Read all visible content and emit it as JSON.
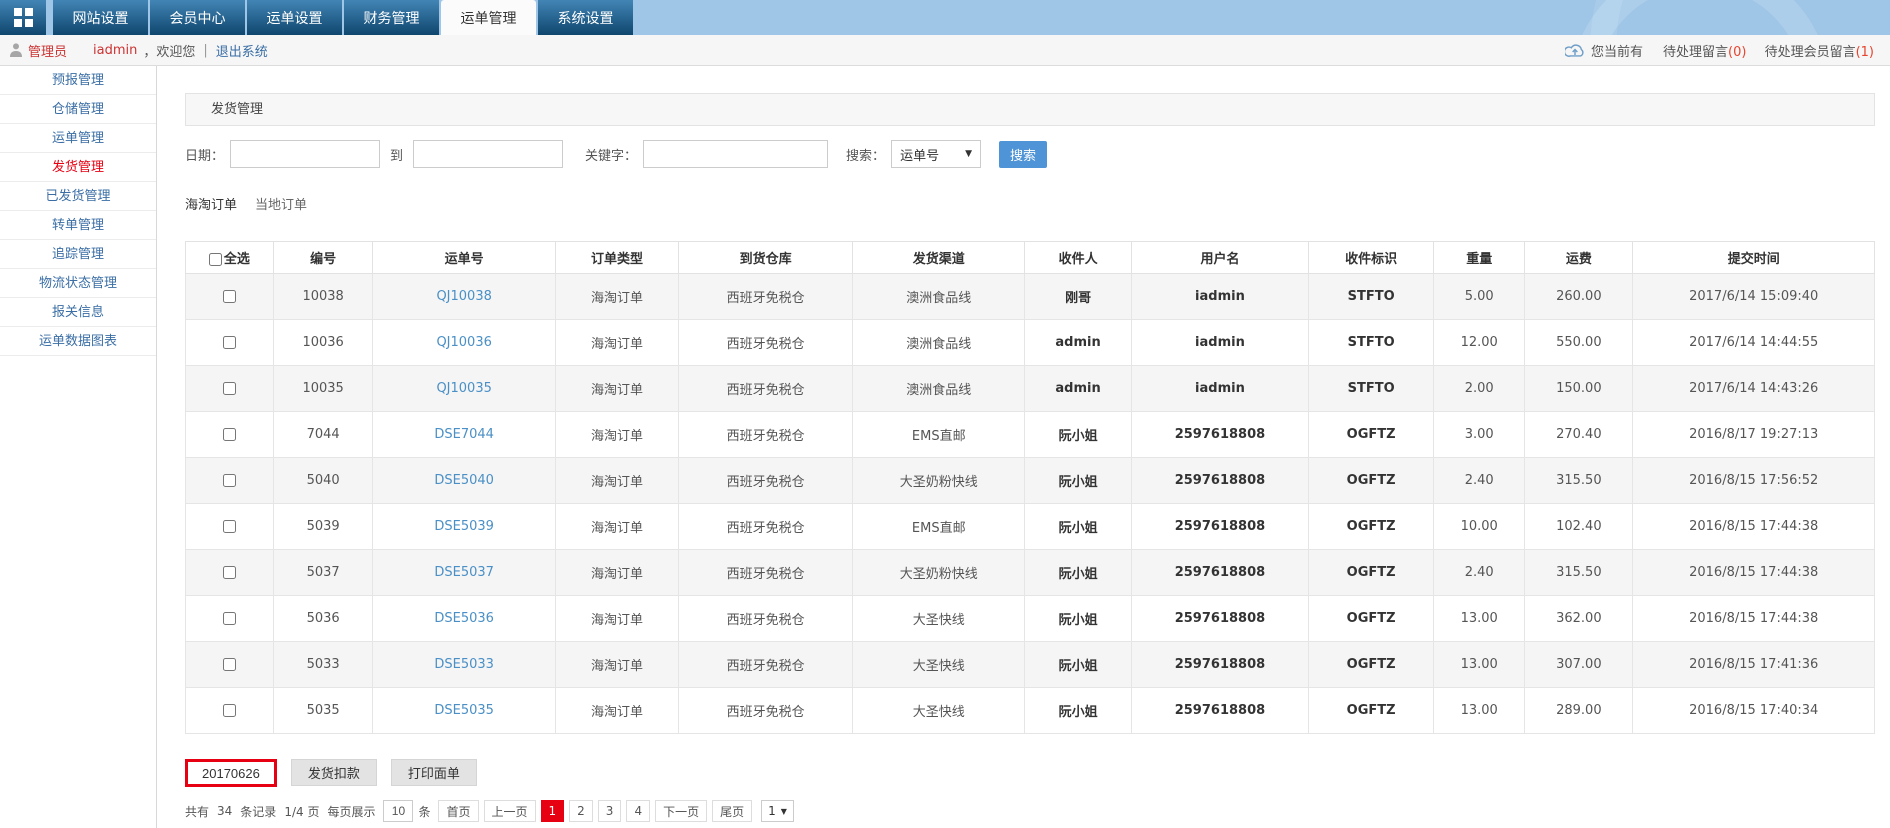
{
  "colors": {
    "navbar_bg": "#9fc6e7",
    "nav_tab_gradient_top": "#4285b5",
    "nav_tab_gradient_bottom": "#0f466e",
    "accent_red": "#e60012",
    "user_red": "#cc3333",
    "table_link_blue": "#4a90c6",
    "search_button_blue": "#4f94d6"
  },
  "nav": {
    "tabs": [
      {
        "label": "网站设置",
        "active": false
      },
      {
        "label": "会员中心",
        "active": false
      },
      {
        "label": "运单设置",
        "active": false
      },
      {
        "label": "财务管理",
        "active": false
      },
      {
        "label": "运单管理",
        "active": true
      },
      {
        "label": "系统设置",
        "active": false
      }
    ]
  },
  "user_bar": {
    "role": "管理员",
    "username": "iadmin",
    "welcome": "，欢迎您",
    "divider": "|",
    "logout": "退出系统",
    "right_prefix": "您当前有",
    "messages": [
      {
        "label": "待处理留言",
        "count": "(0)"
      },
      {
        "label": "待处理会员留言",
        "count": "(1)"
      }
    ]
  },
  "sidebar": {
    "items": [
      {
        "label": "预报管理",
        "active": false
      },
      {
        "label": "仓储管理",
        "active": false
      },
      {
        "label": "运单管理",
        "active": false
      },
      {
        "label": "发货管理",
        "active": true
      },
      {
        "label": "已发货管理",
        "active": false
      },
      {
        "label": "转单管理",
        "active": false
      },
      {
        "label": "追踪管理",
        "active": false
      },
      {
        "label": "物流状态管理",
        "active": false
      },
      {
        "label": "报关信息",
        "active": false
      },
      {
        "label": "运单数据图表",
        "active": false
      }
    ]
  },
  "panel": {
    "title": "发货管理"
  },
  "search": {
    "date_label": "日期：",
    "date_from_value": "",
    "to_label": "到",
    "date_to_value": "",
    "keyword_label": "关键字：",
    "keyword_value": "",
    "search_by_label": "搜索：",
    "search_by_value": "运单号",
    "button_label": "搜索"
  },
  "order_tabs": [
    {
      "label": "海淘订单",
      "active": true
    },
    {
      "label": "当地订单",
      "active": false
    }
  ],
  "table": {
    "select_all_label": "全选",
    "headers": [
      "编号",
      "运单号",
      "订单类型",
      "到货仓库",
      "发货渠道",
      "收件人",
      "用户名",
      "收件标识",
      "重量",
      "运费",
      "提交时间"
    ],
    "rows": [
      {
        "id": "10038",
        "waybill": "QJ10038",
        "order_type": "海淘订单",
        "warehouse": "西班牙免税仓",
        "channel": "澳洲食品线",
        "recipient": "刚哥",
        "username": "iadmin",
        "tag": "STFTO",
        "weight": "5.00",
        "fee": "260.00",
        "time": "2017/6/14 15:09:40"
      },
      {
        "id": "10036",
        "waybill": "QJ10036",
        "order_type": "海淘订单",
        "warehouse": "西班牙免税仓",
        "channel": "澳洲食品线",
        "recipient": "admin",
        "username": "iadmin",
        "tag": "STFTO",
        "weight": "12.00",
        "fee": "550.00",
        "time": "2017/6/14 14:44:55"
      },
      {
        "id": "10035",
        "waybill": "QJ10035",
        "order_type": "海淘订单",
        "warehouse": "西班牙免税仓",
        "channel": "澳洲食品线",
        "recipient": "admin",
        "username": "iadmin",
        "tag": "STFTO",
        "weight": "2.00",
        "fee": "150.00",
        "time": "2017/6/14 14:43:26"
      },
      {
        "id": "7044",
        "waybill": "DSE7044",
        "order_type": "海淘订单",
        "warehouse": "西班牙免税仓",
        "channel": "EMS直邮",
        "recipient": "阮小姐",
        "username": "2597618808",
        "tag": "OGFTZ",
        "weight": "3.00",
        "fee": "270.40",
        "time": "2016/8/17 19:27:13"
      },
      {
        "id": "5040",
        "waybill": "DSE5040",
        "order_type": "海淘订单",
        "warehouse": "西班牙免税仓",
        "channel": "大圣奶粉快线",
        "recipient": "阮小姐",
        "username": "2597618808",
        "tag": "OGFTZ",
        "weight": "2.40",
        "fee": "315.50",
        "time": "2016/8/15 17:56:52"
      },
      {
        "id": "5039",
        "waybill": "DSE5039",
        "order_type": "海淘订单",
        "warehouse": "西班牙免税仓",
        "channel": "EMS直邮",
        "recipient": "阮小姐",
        "username": "2597618808",
        "tag": "OGFTZ",
        "weight": "10.00",
        "fee": "102.40",
        "time": "2016/8/15 17:44:38"
      },
      {
        "id": "5037",
        "waybill": "DSE5037",
        "order_type": "海淘订单",
        "warehouse": "西班牙免税仓",
        "channel": "大圣奶粉快线",
        "recipient": "阮小姐",
        "username": "2597618808",
        "tag": "OGFTZ",
        "weight": "2.40",
        "fee": "315.50",
        "time": "2016/8/15 17:44:38"
      },
      {
        "id": "5036",
        "waybill": "DSE5036",
        "order_type": "海淘订单",
        "warehouse": "西班牙免税仓",
        "channel": "大圣快线",
        "recipient": "阮小姐",
        "username": "2597618808",
        "tag": "OGFTZ",
        "weight": "13.00",
        "fee": "362.00",
        "time": "2016/8/15 17:44:38"
      },
      {
        "id": "5033",
        "waybill": "DSE5033",
        "order_type": "海淘订单",
        "warehouse": "西班牙免税仓",
        "channel": "大圣快线",
        "recipient": "阮小姐",
        "username": "2597618808",
        "tag": "OGFTZ",
        "weight": "13.00",
        "fee": "307.00",
        "time": "2016/8/15 17:41:36"
      },
      {
        "id": "5035",
        "waybill": "DSE5035",
        "order_type": "海淘订单",
        "warehouse": "西班牙免税仓",
        "channel": "大圣快线",
        "recipient": "阮小姐",
        "username": "2597618808",
        "tag": "OGFTZ",
        "weight": "13.00",
        "fee": "289.00",
        "time": "2016/8/15 17:40:34"
      }
    ]
  },
  "actions": {
    "batch_label": "20170626",
    "deduct_label": "发货扣款",
    "print_label": "打印面单"
  },
  "pagination": {
    "total_prefix": "共有",
    "total_count": "34",
    "total_suffix": "条记录",
    "page_ratio": "1/4 页",
    "per_page_prefix": "每页展示",
    "per_page_value": "10",
    "per_page_suffix": "条",
    "first_label": "首页",
    "prev_label": "上一页",
    "pages": [
      {
        "label": "1",
        "active": true
      },
      {
        "label": "2",
        "active": false
      },
      {
        "label": "3",
        "active": false
      },
      {
        "label": "4",
        "active": false
      }
    ],
    "next_label": "下一页",
    "last_label": "尾页",
    "jump_value": "1"
  }
}
